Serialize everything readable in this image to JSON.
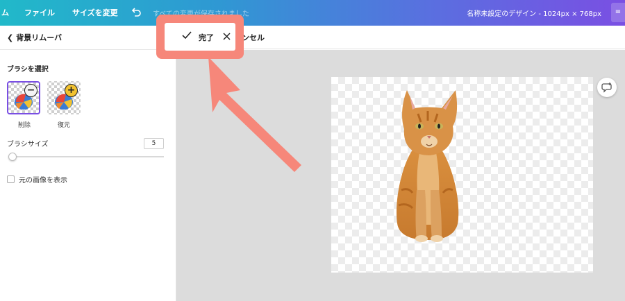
{
  "topbar": {
    "menu_partial": "ム",
    "file_menu": "ファイル",
    "resize_menu": "サイズを変更",
    "saving_status": "すべての変更が保存されました",
    "document_title": "名称未設定のデザイン - 1024px × 768px",
    "right_button": "≡"
  },
  "toolbar": {
    "done_label": "完了",
    "cancel_label": "ャンセル"
  },
  "panel": {
    "back_label": "背景リムーバ",
    "brush_heading": "ブラシを選択",
    "erase_caption": "削除",
    "restore_caption": "復元",
    "brush_size_label": "ブラシサイズ",
    "brush_size_value": "5",
    "brush_size_fraction": 0.03,
    "show_original_label": "元の画像を表示",
    "show_original_checked": false
  },
  "colors": {
    "accent": "#7a4fe3",
    "highlight": "#f6877a",
    "canvas_bg": "#dcdcdc"
  },
  "icons": [
    "undo-icon",
    "check-icon",
    "close-icon",
    "chevron-left-icon",
    "minus-icon",
    "plus-icon",
    "comment-add-icon"
  ]
}
